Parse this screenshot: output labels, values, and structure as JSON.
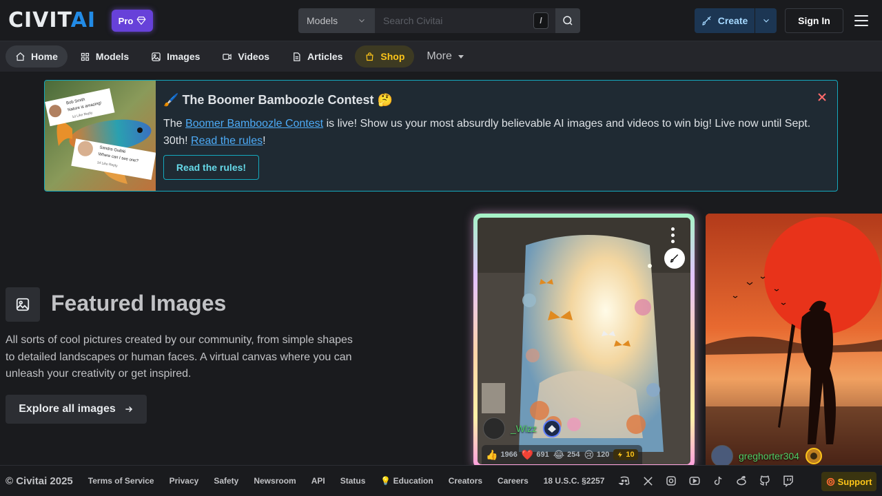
{
  "header": {
    "logo_civit": "CIVIT",
    "logo_ai": "AI",
    "pro_label": "Pro",
    "search_category": "Models",
    "search_placeholder": "Search Civitai",
    "search_shortcut": "/",
    "create_label": "Create",
    "signin_label": "Sign In"
  },
  "subnav": {
    "items": [
      {
        "label": "Home",
        "icon": "home-icon",
        "active": true
      },
      {
        "label": "Models",
        "icon": "models-icon"
      },
      {
        "label": "Images",
        "icon": "images-icon"
      },
      {
        "label": "Videos",
        "icon": "videos-icon"
      },
      {
        "label": "Articles",
        "icon": "articles-icon"
      },
      {
        "label": "Shop",
        "icon": "shop-icon"
      }
    ],
    "more_label": "More"
  },
  "banner": {
    "emoji_start": "🖌️",
    "title": "The Boomer Bamboozle Contest",
    "emoji_end": "🤔",
    "text_prefix": "The ",
    "link_contest": "Boomer Bamboozle Contest",
    "text_middle": " is live! Show us your most absurdly believable AI images and videos to win big! Live now until Sept. 30th! ",
    "link_rules": "Read the rules",
    "text_suffix": "!",
    "button_label": "Read the rules!",
    "comment1_name": "Bob Smith",
    "comment1_text": "Nature is amazing!",
    "comment1_meta": "1d  Like  Reply",
    "comment2_name": "Sandra Guiblé",
    "comment2_text": "Where can I see one?",
    "comment2_meta": "1d  Like  Reply"
  },
  "featured": {
    "title": "Featured Images",
    "description": "All sorts of cool pictures created by our community, from simple shapes to detailed landscapes or human faces. A virtual canvas where you can unleash your creativity or get inspired.",
    "explore_label": "Explore all images"
  },
  "cards": [
    {
      "username": "_Wizz",
      "reactions": {
        "like": "1966",
        "heart": "691",
        "laugh": "254",
        "cry": "120",
        "buzz": "10"
      }
    },
    {
      "username": "greghorter304"
    }
  ],
  "footer": {
    "copyright": "© Civitai 2025",
    "links": [
      "Terms of Service",
      "Privacy",
      "Safety",
      "Newsroom",
      "API",
      "Status",
      "💡 Education",
      "Creators",
      "Careers",
      "18 U.S.C. §2257"
    ],
    "social_icons": [
      "discord-icon",
      "x-icon",
      "instagram-icon",
      "youtube-icon",
      "tiktok-icon",
      "reddit-icon",
      "github-icon",
      "twitch-icon"
    ],
    "support_label": "Support"
  },
  "colors": {
    "accent_blue": "#228be6",
    "pro_purple": "#6741d9",
    "banner_border": "#15aabf",
    "shop_yellow": "#fcc419",
    "username_green": "#51cf66"
  }
}
